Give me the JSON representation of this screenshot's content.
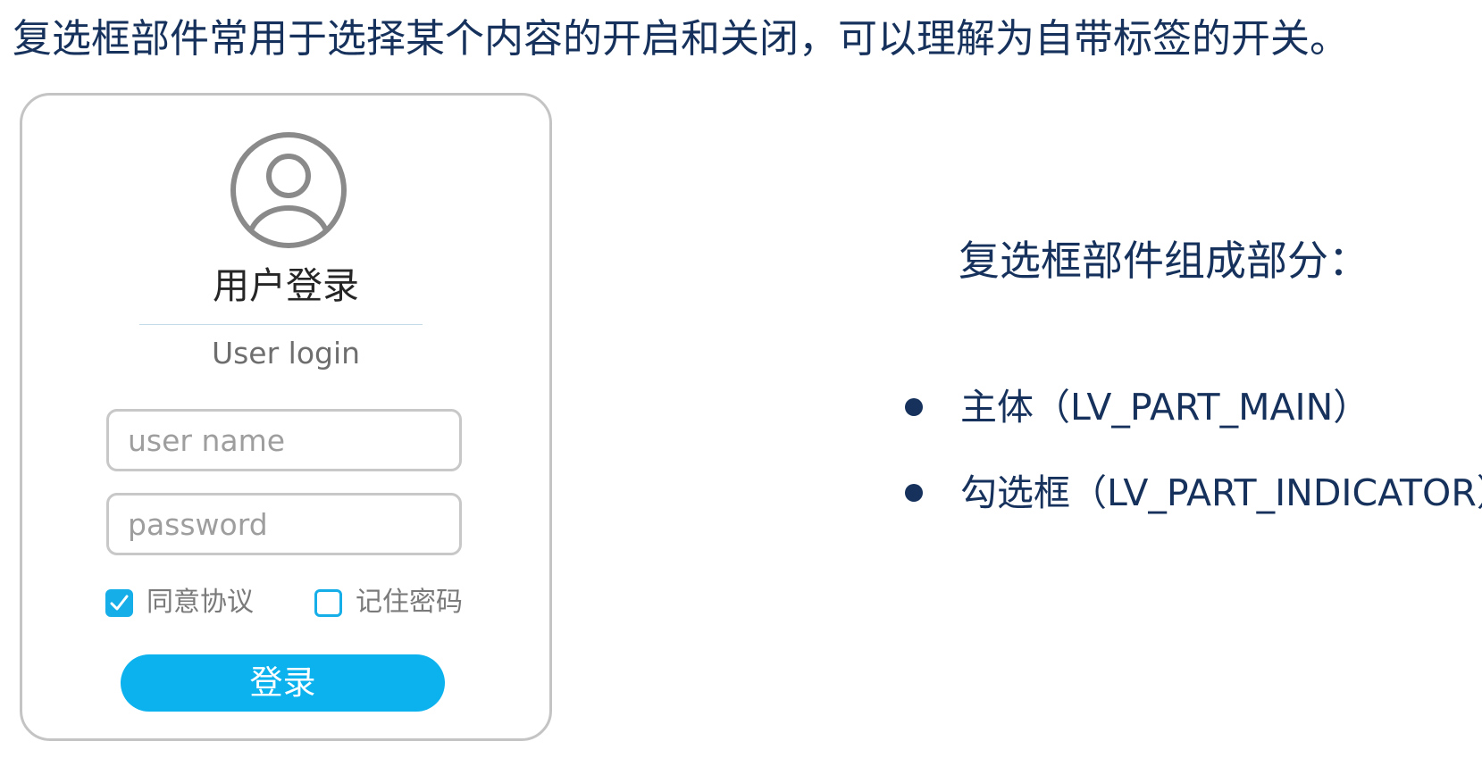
{
  "headline": "复选框部件常用于选择某个内容的开启和关闭，可以理解为自带标签的开关。",
  "login_card": {
    "title": "用户登录",
    "subtitle": "User login",
    "username_placeholder": "user name",
    "password_placeholder": "password",
    "checkboxes": [
      {
        "label": "同意协议",
        "checked": true
      },
      {
        "label": "记住密码",
        "checked": false
      }
    ],
    "login_button": "登录"
  },
  "parts": {
    "heading": "复选框部件组成部分：",
    "items": [
      "主体（LV_PART_MAIN）",
      "勾选框（LV_PART_INDICATOR）"
    ]
  },
  "colors": {
    "text_navy": "#16325c",
    "accent_blue": "#0bb2ee",
    "card_border": "#c4c4c4"
  },
  "icons": {
    "avatar": "user-circle-icon",
    "checkbox_checked": "checkmark-icon",
    "bullet": "bullet-dot-icon"
  }
}
